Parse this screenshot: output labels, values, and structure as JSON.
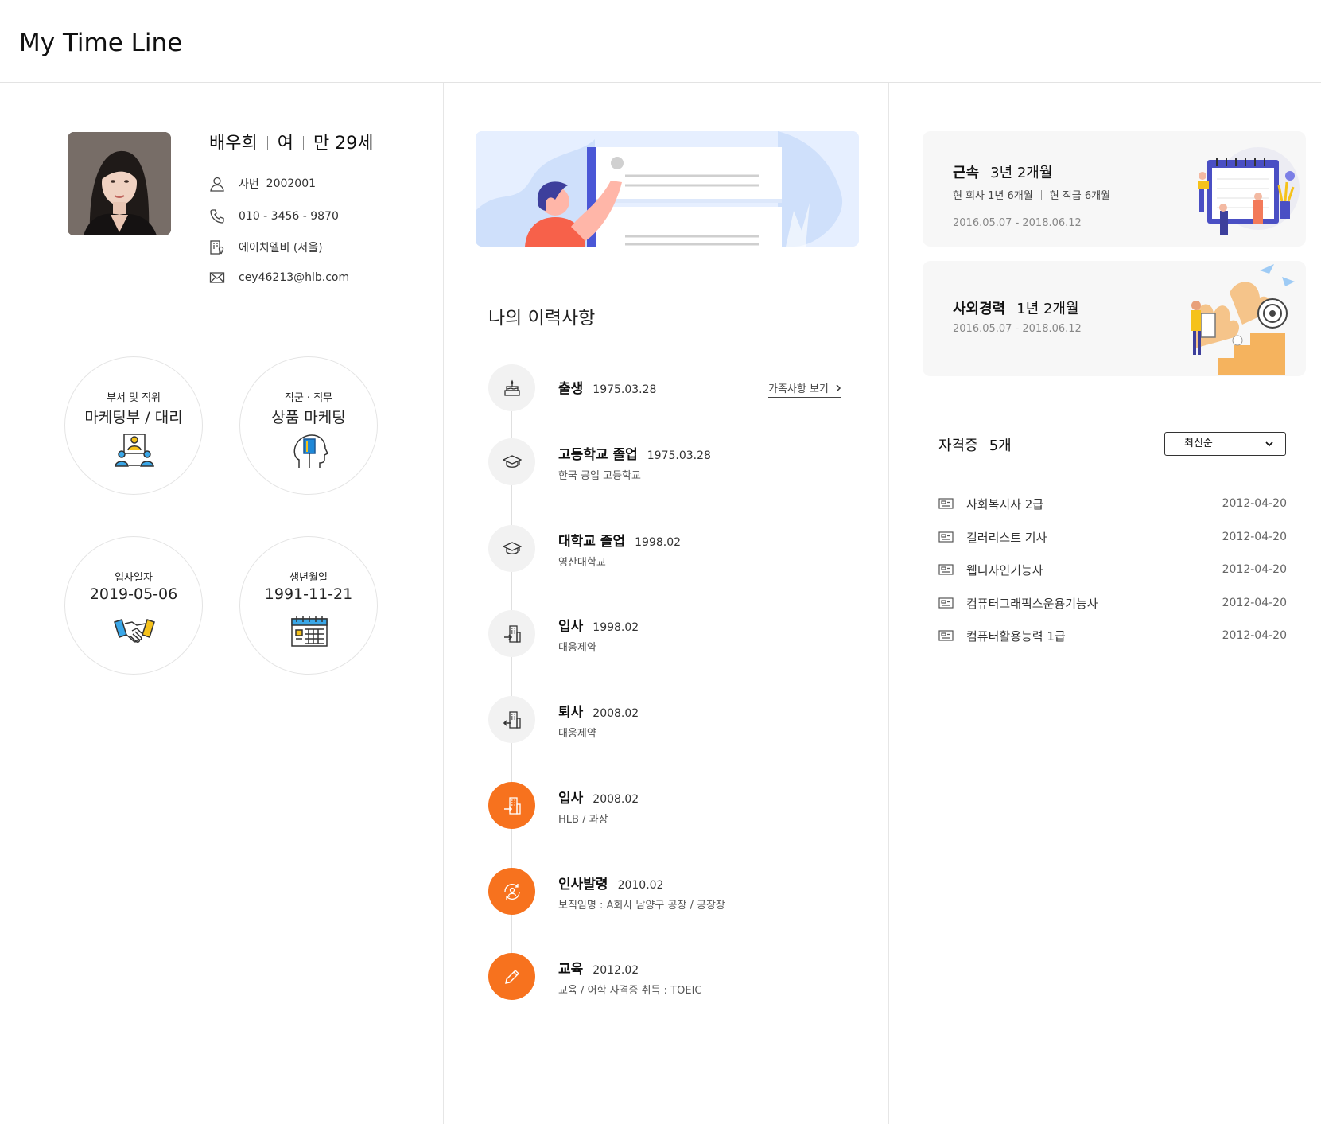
{
  "header": {
    "title": "My Time Line"
  },
  "profile": {
    "name": "배우희",
    "gender": "여",
    "age": "만 29세",
    "emp_id_label": "사번",
    "emp_id": "2002001",
    "phone": "010 - 3456 - 9870",
    "company": "에이치엘비 (서울)",
    "email": "cey46213@hlb.com"
  },
  "circles": [
    {
      "label": "부서 및 직위",
      "value": "마케팅부 / 대리",
      "icon": "team-icon"
    },
    {
      "label": "직군 · 직무",
      "value": "상품 마케팅",
      "icon": "head-book-icon"
    },
    {
      "label": "입사일자",
      "value": "2019-05-06",
      "icon": "handshake-icon"
    },
    {
      "label": "생년월일",
      "value": "1991-11-21",
      "icon": "calendar-icon"
    }
  ],
  "history": {
    "title": "나의 이력사항",
    "family_link": "가족사항 보기",
    "items": [
      {
        "title": "출생",
        "date": "1975.03.28",
        "sub": "",
        "icon": "cake-icon",
        "active": false
      },
      {
        "title": "고등학교 졸업",
        "date": "1975.03.28",
        "sub": "한국 공업 고등학교",
        "icon": "graduation-cap-icon",
        "active": false
      },
      {
        "title": "대학교 졸업",
        "date": "1998.02",
        "sub": "영산대학교",
        "icon": "graduation-cap-icon",
        "active": false
      },
      {
        "title": "입사",
        "date": "1998.02",
        "sub": "대웅제약",
        "icon": "building-enter-icon",
        "active": false
      },
      {
        "title": "퇴사",
        "date": "2008.02",
        "sub": "대웅제약",
        "icon": "building-exit-icon",
        "active": false
      },
      {
        "title": "입사",
        "date": "2008.02",
        "sub": "HLB / 과장",
        "icon": "building-enter-icon",
        "active": true
      },
      {
        "title": "인사발령",
        "date": "2010.02",
        "sub": "보직임명 : A회사 남양구 공장 / 공장장",
        "icon": "person-rotate-icon",
        "active": true
      },
      {
        "title": "교육",
        "date": "2012.02",
        "sub": "교육 / 어학 자격증 취득 : TOEIC",
        "icon": "pencil-icon",
        "active": true
      }
    ]
  },
  "tenure": {
    "title": "근속",
    "value": "3년 2개월",
    "sub_company": "현 회사 1년 6개월",
    "sub_position": "현 직급 6개월",
    "period": "2016.05.07 - 2018.06.12"
  },
  "social": {
    "title": "사외경력",
    "value": "1년 2개월",
    "period": "2016.05.07 - 2018.06.12"
  },
  "certs": {
    "title": "자격증",
    "count": "5개",
    "sort": "최신순",
    "items": [
      {
        "name": "사회복지사 2급",
        "date": "2012-04-20"
      },
      {
        "name": "컬러리스트 기사",
        "date": "2012-04-20"
      },
      {
        "name": "웹디자인기능사",
        "date": "2012-04-20"
      },
      {
        "name": "컴퓨터그래픽스운용기능사",
        "date": "2012-04-20"
      },
      {
        "name": "컴퓨터활용능력 1급",
        "date": "2012-04-20"
      }
    ]
  },
  "colors": {
    "accent": "#f7721e",
    "banner": "#e6efff",
    "card": "#f7f7f7"
  }
}
